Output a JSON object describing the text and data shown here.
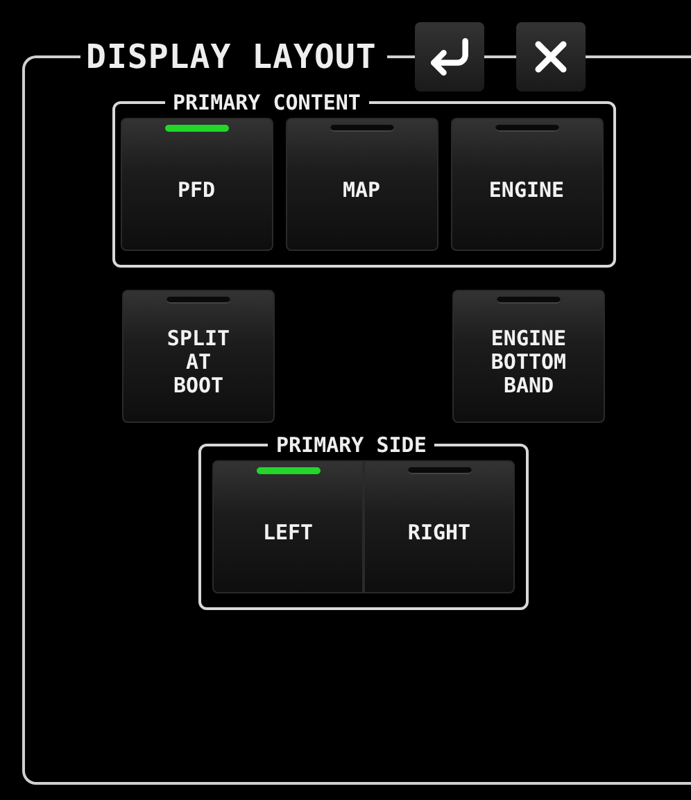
{
  "title": "DISPLAY LAYOUT",
  "primary_content": {
    "label": "PRIMARY CONTENT",
    "options": [
      {
        "label": "PFD",
        "selected": true
      },
      {
        "label": "MAP",
        "selected": false
      },
      {
        "label": "ENGINE",
        "selected": false
      }
    ]
  },
  "toggles": [
    {
      "label": "SPLIT AT BOOT",
      "on": false
    },
    {
      "label": "ENGINE BOTTOM BAND",
      "on": false
    }
  ],
  "primary_side": {
    "label": "PRIMARY SIDE",
    "options": [
      {
        "label": "LEFT",
        "selected": true
      },
      {
        "label": "RIGHT",
        "selected": false
      }
    ]
  }
}
